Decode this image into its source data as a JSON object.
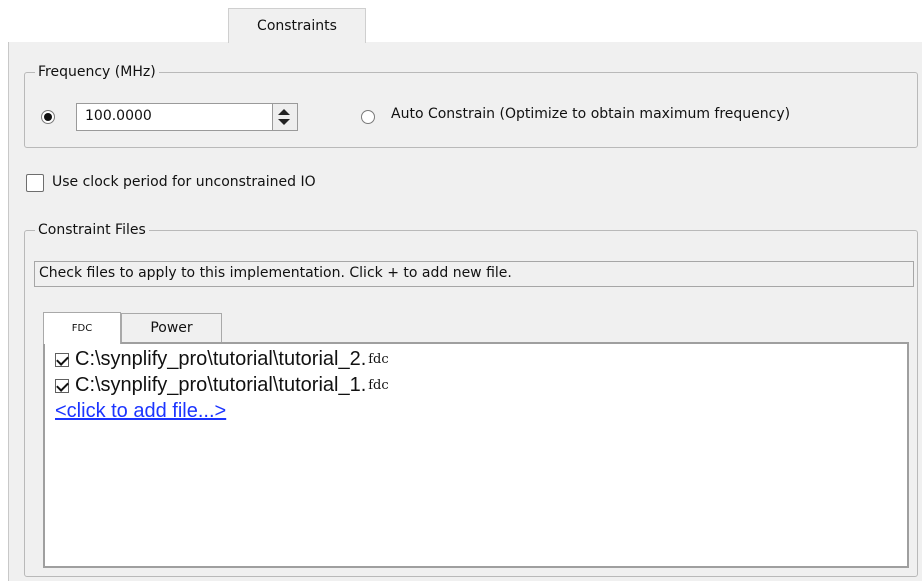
{
  "top_tab": {
    "label": "Constraints"
  },
  "frequency": {
    "title": "Frequency (MHz)",
    "value": "100.0000",
    "auto_label": "Auto Constrain (Optimize to obtain maximum frequency)"
  },
  "clock_period_label": "Use clock period for unconstrained IO",
  "constraint_files": {
    "title": "Constraint Files",
    "hint": "Check files to apply to this implementation. Click + to add new file.",
    "tabs": [
      {
        "label": "FDC"
      },
      {
        "label": "Power"
      }
    ],
    "files": [
      {
        "path": "C:\\synplify_pro\\tutorial\\tutorial_2.",
        "ext": "fdc",
        "checked": true
      },
      {
        "path": "C:\\synplify_pro\\tutorial\\tutorial_1.",
        "ext": "fdc",
        "checked": true
      }
    ],
    "add_link": "<click to add file...>"
  }
}
